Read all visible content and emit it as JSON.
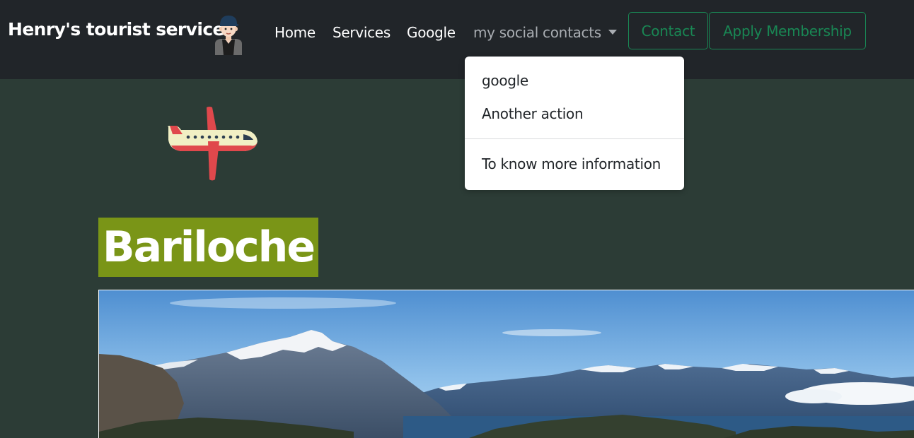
{
  "navbar": {
    "brand": "Henry's tourist service",
    "links": {
      "home": "Home",
      "services": "Services",
      "google": "Google",
      "dropdown": "my social contacts"
    },
    "buttons": {
      "contact": "Contact",
      "apply": "Apply Membership"
    }
  },
  "dropdown": {
    "items": [
      "google",
      "Another action",
      "To know more information"
    ]
  },
  "hero": {
    "title": "Bariloche"
  },
  "colors": {
    "navbar_bg": "#212529",
    "page_bg": "#2c3c36",
    "accent_green": "#198754",
    "title_bg": "#7a9517"
  },
  "icons": [
    "avatar-icon",
    "airplane-icon",
    "caret-down-icon"
  ]
}
